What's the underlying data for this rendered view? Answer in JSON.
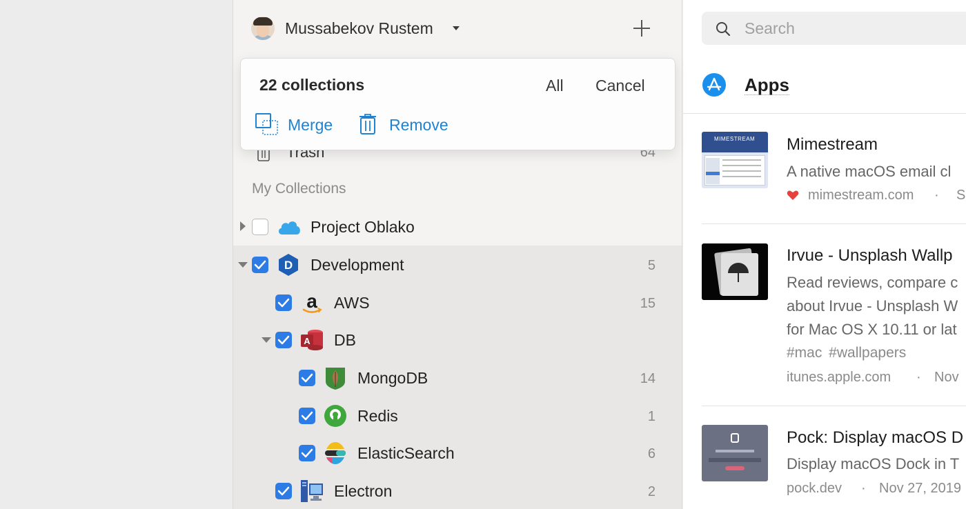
{
  "user": {
    "name": "Mussabekov Rustem"
  },
  "selection": {
    "count_label": "22 collections",
    "all_label": "All",
    "cancel_label": "Cancel",
    "merge_label": "Merge",
    "remove_label": "Remove"
  },
  "trash": {
    "label": "Trash",
    "count": "64"
  },
  "section_title": "My Collections",
  "collections": [
    {
      "label": "Project Oblako",
      "count": "",
      "checked": false,
      "expanded": false,
      "icon": "cloud-icon"
    },
    {
      "label": "Development",
      "count": "5",
      "checked": true,
      "expanded": true,
      "icon": "development-d-icon"
    },
    {
      "label": "AWS",
      "count": "15",
      "checked": true,
      "icon": "amazon-icon"
    },
    {
      "label": "DB",
      "count": "",
      "checked": true,
      "expanded": true,
      "icon": "access-database-icon"
    },
    {
      "label": "MongoDB",
      "count": "14",
      "checked": true,
      "icon": "mongodb-leaf-icon"
    },
    {
      "label": "Redis",
      "count": "1",
      "checked": true,
      "icon": "redis-open-source-icon"
    },
    {
      "label": "ElasticSearch",
      "count": "6",
      "checked": true,
      "icon": "elasticsearch-icon"
    },
    {
      "label": "Electron",
      "count": "2",
      "checked": true,
      "icon": "computer-icon"
    }
  ],
  "search": {
    "placeholder": "Search"
  },
  "current_collection": {
    "title": "Apps",
    "icon": "app-store-icon"
  },
  "bookmarks": [
    {
      "title": "Mimestream",
      "excerpt": [
        "A native macOS email cl"
      ],
      "tags": "",
      "domain": "mimestream.com",
      "separator": "·",
      "date": "S",
      "favorite": true,
      "thumb_text": "MIMESTREAM"
    },
    {
      "title": "Irvue - Unsplash Wallp",
      "excerpt": [
        "Read reviews, compare c",
        "about Irvue - Unsplash W",
        "for Mac OS X 10.11 or lat"
      ],
      "tags": "#mac  #wallpapers",
      "domain": "itunes.apple.com",
      "separator": "·",
      "date": "Nov",
      "favorite": false
    },
    {
      "title": "Pock: Display macOS D",
      "excerpt": [
        "Display macOS Dock in T"
      ],
      "tags": "",
      "domain": "pock.dev",
      "separator": "·",
      "date": "Nov 27, 2019",
      "favorite": false
    }
  ],
  "colors": {
    "accent": "#1f82d2",
    "checkbox": "#2d7be5",
    "favorite": "#e8413b"
  }
}
